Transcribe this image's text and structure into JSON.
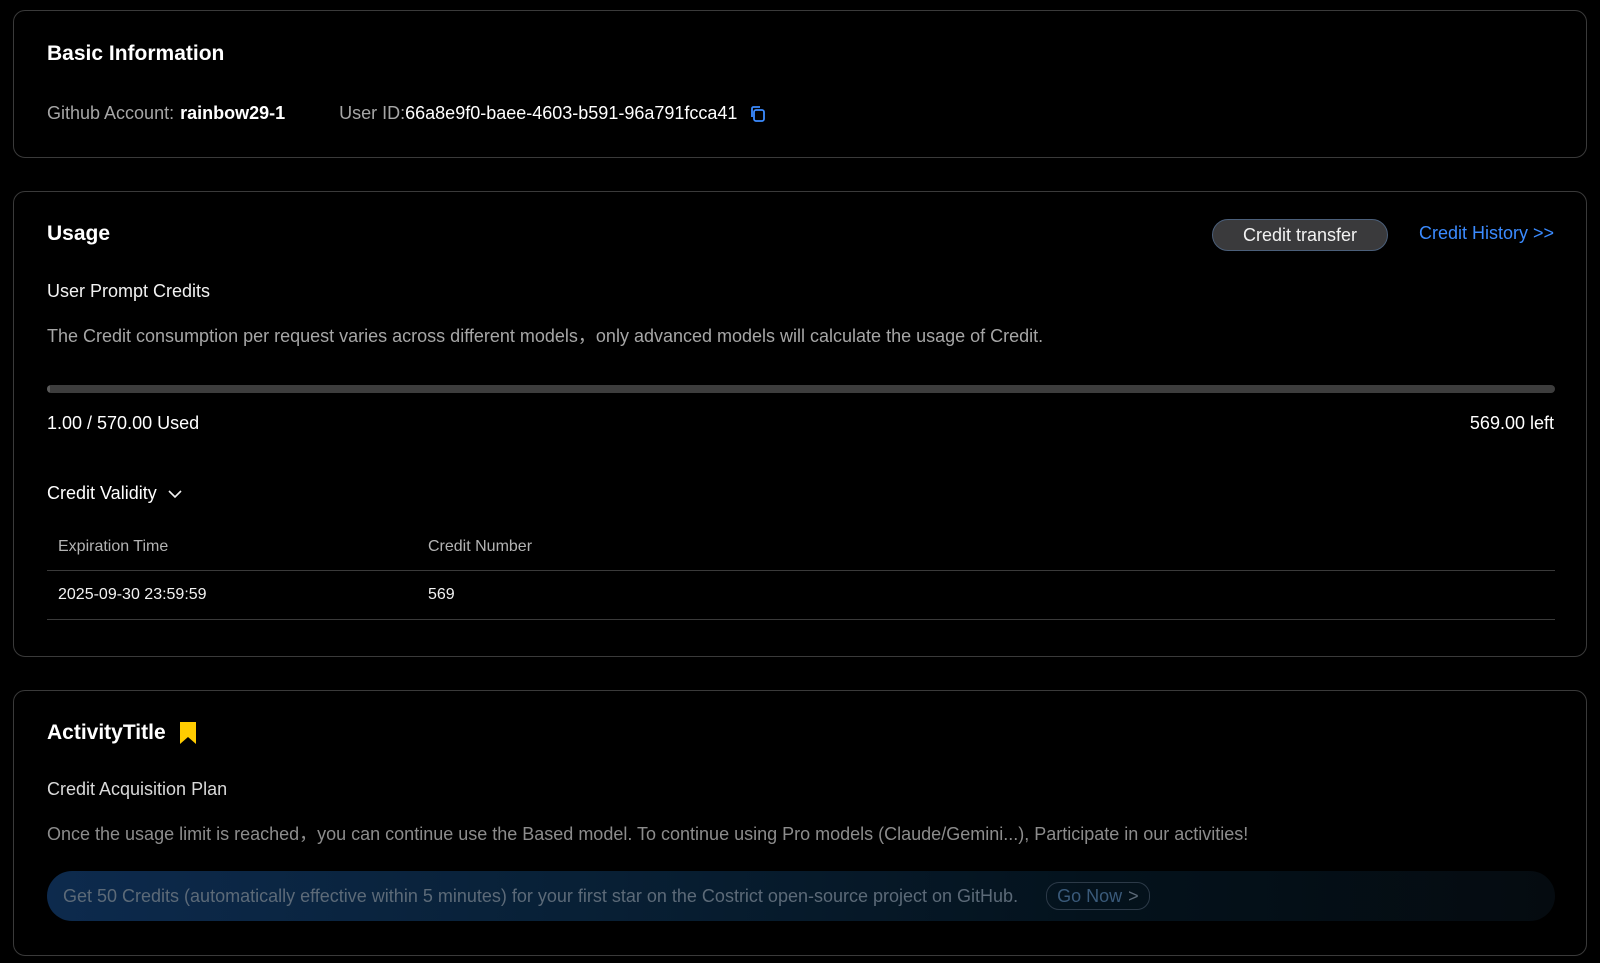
{
  "basic": {
    "title": "Basic Information",
    "github_label": "Github Account:",
    "github_value": "rainbow29-1",
    "user_id_label": "User ID:",
    "user_id_value": "66a8e9f0-baee-4603-b591-96a791fcca41",
    "copy_icon": "copy-icon"
  },
  "usage": {
    "title": "Usage",
    "credit_transfer_label": "Credit transfer",
    "credit_history_label": "Credit History >>",
    "subtitle": "User Prompt Credits",
    "description": "The Credit consumption per request varies across different models，only advanced models will calculate the usage of Credit.",
    "used": 1.0,
    "total": 570.0,
    "used_text": "1.00 / 570.00 Used",
    "left_text": "569.00 left",
    "validity_label": "Credit Validity",
    "table": {
      "headers": [
        "Expiration Time",
        "Credit Number"
      ],
      "rows": [
        [
          "2025-09-30 23:59:59",
          "569"
        ]
      ]
    }
  },
  "activity": {
    "title": "ActivityTitle",
    "bookmark_icon": "bookmark-icon",
    "bookmark_color": "#ffcc00",
    "subtitle": "Credit Acquisition Plan",
    "description": "Once the usage limit is reached，you can continue use the Based model. To continue using Pro models (Claude/Gemini...), Participate in our activities!",
    "promo_text": "Get 50 Credits (automatically effective within 5 minutes) for your first star on the Costrict open-source project on GitHub.",
    "promo_button_label": "Go Now",
    "promo_button_arrow": ">"
  },
  "colors": {
    "accent_link": "#3b8bff",
    "background": "#000000",
    "card_border": "#3a3a3a"
  }
}
